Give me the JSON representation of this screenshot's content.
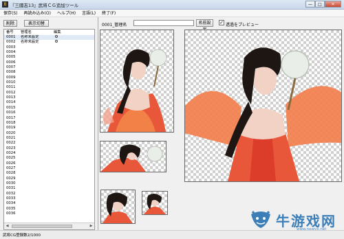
{
  "window": {
    "title": "『三國志13』武将ＣＧ追加ツール",
    "buttons": [
      "—",
      "□",
      "✕"
    ]
  },
  "menu": [
    "保存(S)",
    "再読み込み(O)",
    "ヘルプ(H)",
    "言語(L)",
    "終了(F)"
  ],
  "toolbar": {
    "delete_label": "削除",
    "toggle_label": "表示切替"
  },
  "list": {
    "columns": [
      "番号",
      "管理名",
      "編集"
    ],
    "rows": [
      {
        "num": "0001",
        "name": "名称未設定",
        "edit": true
      },
      {
        "num": "0002",
        "name": "名称未設定",
        "edit": true
      },
      {
        "num": "0003",
        "name": "",
        "edit": false
      },
      {
        "num": "0004",
        "name": "",
        "edit": false
      },
      {
        "num": "0005",
        "name": "",
        "edit": false
      },
      {
        "num": "0006",
        "name": "",
        "edit": false
      },
      {
        "num": "0007",
        "name": "",
        "edit": false
      },
      {
        "num": "0008",
        "name": "",
        "edit": false
      },
      {
        "num": "0009",
        "name": "",
        "edit": false
      },
      {
        "num": "0010",
        "name": "",
        "edit": false
      },
      {
        "num": "0011",
        "name": "",
        "edit": false
      },
      {
        "num": "0012",
        "name": "",
        "edit": false
      },
      {
        "num": "0013",
        "name": "",
        "edit": false
      },
      {
        "num": "0014",
        "name": "",
        "edit": false
      },
      {
        "num": "0015",
        "name": "",
        "edit": false
      },
      {
        "num": "0016",
        "name": "",
        "edit": false
      },
      {
        "num": "0017",
        "name": "",
        "edit": false
      },
      {
        "num": "0018",
        "name": "",
        "edit": false
      },
      {
        "num": "0019",
        "name": "",
        "edit": false
      },
      {
        "num": "0020",
        "name": "",
        "edit": false
      },
      {
        "num": "0021",
        "name": "",
        "edit": false
      },
      {
        "num": "0022",
        "name": "",
        "edit": false
      },
      {
        "num": "0023",
        "name": "",
        "edit": false
      },
      {
        "num": "0024",
        "name": "",
        "edit": false
      },
      {
        "num": "0025",
        "name": "",
        "edit": false
      },
      {
        "num": "0026",
        "name": "",
        "edit": false
      },
      {
        "num": "0027",
        "name": "",
        "edit": false
      },
      {
        "num": "0028",
        "name": "",
        "edit": false
      },
      {
        "num": "0029",
        "name": "",
        "edit": false
      },
      {
        "num": "0030",
        "name": "",
        "edit": false
      },
      {
        "num": "0031",
        "name": "",
        "edit": false
      },
      {
        "num": "0032",
        "name": "",
        "edit": false
      },
      {
        "num": "0033",
        "name": "",
        "edit": false
      },
      {
        "num": "0034",
        "name": "",
        "edit": false
      },
      {
        "num": "0035",
        "name": "",
        "edit": false
      },
      {
        "num": "0036",
        "name": "",
        "edit": false
      }
    ]
  },
  "editor": {
    "name_label": "0001_管理名",
    "name_value": "",
    "name_button": "名前設定",
    "preview_checked": true,
    "preview_label": "透過をプレビュー"
  },
  "status": {
    "text": "武将CG登録数2/1000"
  },
  "watermark": {
    "text": "牛游戏网",
    "url": "www.newyx.net"
  },
  "colors": {
    "accent": "#3c7fb8",
    "dress": "#e8573a",
    "skin": "#f2d2c4",
    "hair": "#1d1612"
  }
}
